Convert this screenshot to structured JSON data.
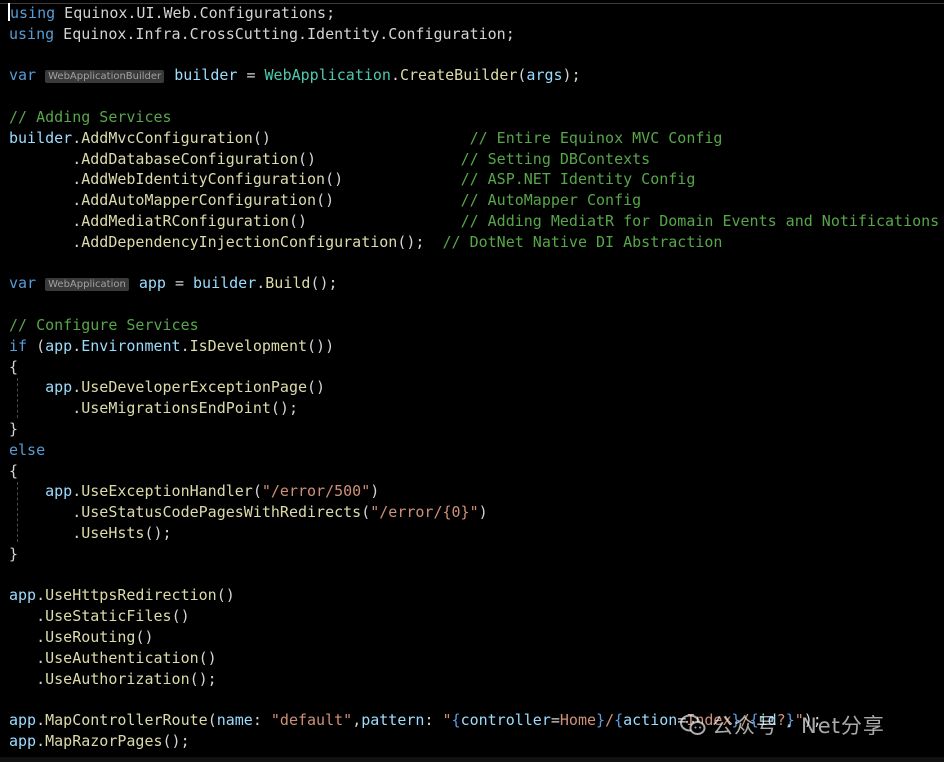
{
  "editor": {
    "lines": [
      [
        {
          "t": "using",
          "c": "kw"
        },
        {
          "t": " Equinox.UI.Web.Configurations;",
          "c": "pn"
        }
      ],
      [
        {
          "t": "using",
          "c": "kw"
        },
        {
          "t": " Equinox.Infra.CrossCutting.Identity.Configuration;",
          "c": "pn"
        }
      ],
      [],
      [
        {
          "t": "var",
          "c": "kw"
        },
        {
          "t": " ",
          "c": "pn"
        },
        {
          "t": "WebApplicationBuilder",
          "c": "hint"
        },
        {
          "t": " builder",
          "c": "va"
        },
        {
          "t": " = ",
          "c": "pn"
        },
        {
          "t": "WebApplication",
          "c": "ty"
        },
        {
          "t": ".",
          "c": "pn"
        },
        {
          "t": "CreateBuilder",
          "c": "fn"
        },
        {
          "t": "(",
          "c": "pn"
        },
        {
          "t": "args",
          "c": "va"
        },
        {
          "t": ");",
          "c": "pn"
        }
      ],
      [],
      [
        {
          "t": "// Adding Services",
          "c": "cm"
        }
      ],
      [
        {
          "t": "builder",
          "c": "va"
        },
        {
          "t": ".",
          "c": "pn"
        },
        {
          "t": "AddMvcConfiguration",
          "c": "fn"
        },
        {
          "t": "()                      ",
          "c": "pn"
        },
        {
          "t": "// Entire Equinox MVC Config",
          "c": "cm"
        }
      ],
      [
        {
          "t": "       .",
          "c": "pn"
        },
        {
          "t": "AddDatabaseConfiguration",
          "c": "fn"
        },
        {
          "t": "()                ",
          "c": "pn"
        },
        {
          "t": "// Setting DBContexts",
          "c": "cm"
        }
      ],
      [
        {
          "t": "       .",
          "c": "pn"
        },
        {
          "t": "AddWebIdentityConfiguration",
          "c": "fn"
        },
        {
          "t": "()             ",
          "c": "pn"
        },
        {
          "t": "// ASP.NET Identity Config",
          "c": "cm"
        }
      ],
      [
        {
          "t": "       .",
          "c": "pn"
        },
        {
          "t": "AddAutoMapperConfiguration",
          "c": "fn"
        },
        {
          "t": "()              ",
          "c": "pn"
        },
        {
          "t": "// AutoMapper Config",
          "c": "cm"
        }
      ],
      [
        {
          "t": "       .",
          "c": "pn"
        },
        {
          "t": "AddMediatRConfiguration",
          "c": "fn"
        },
        {
          "t": "()                 ",
          "c": "pn"
        },
        {
          "t": "// Adding MediatR for Domain Events and Notifications",
          "c": "cm"
        }
      ],
      [
        {
          "t": "       .",
          "c": "pn"
        },
        {
          "t": "AddDependencyInjectionConfiguration",
          "c": "fn"
        },
        {
          "t": "();  ",
          "c": "pn"
        },
        {
          "t": "// DotNet Native DI Abstraction",
          "c": "cm"
        }
      ],
      [],
      [
        {
          "t": "var",
          "c": "kw"
        },
        {
          "t": " ",
          "c": "pn"
        },
        {
          "t": "WebApplication",
          "c": "hint"
        },
        {
          "t": " app",
          "c": "va"
        },
        {
          "t": " = ",
          "c": "pn"
        },
        {
          "t": "builder",
          "c": "va"
        },
        {
          "t": ".",
          "c": "pn"
        },
        {
          "t": "Build",
          "c": "fn"
        },
        {
          "t": "();",
          "c": "pn"
        }
      ],
      [],
      [
        {
          "t": "// Configure Services",
          "c": "cm"
        }
      ],
      [
        {
          "t": "if",
          "c": "kw"
        },
        {
          "t": " (",
          "c": "pn"
        },
        {
          "t": "app",
          "c": "va"
        },
        {
          "t": ".",
          "c": "pn"
        },
        {
          "t": "Environment",
          "c": "va"
        },
        {
          "t": ".",
          "c": "pn"
        },
        {
          "t": "IsDevelopment",
          "c": "fn"
        },
        {
          "t": "())",
          "c": "pn"
        }
      ],
      [
        {
          "t": "{",
          "c": "pn"
        }
      ],
      [
        {
          "t": "    ",
          "c": "pn"
        },
        {
          "t": "app",
          "c": "va"
        },
        {
          "t": ".",
          "c": "pn"
        },
        {
          "t": "UseDeveloperExceptionPage",
          "c": "fn"
        },
        {
          "t": "()",
          "c": "pn"
        }
      ],
      [
        {
          "t": "       .",
          "c": "pn"
        },
        {
          "t": "UseMigrationsEndPoint",
          "c": "fn"
        },
        {
          "t": "();",
          "c": "pn"
        }
      ],
      [
        {
          "t": "}",
          "c": "pn"
        }
      ],
      [
        {
          "t": "else",
          "c": "kw"
        }
      ],
      [
        {
          "t": "{",
          "c": "pn"
        }
      ],
      [
        {
          "t": "    ",
          "c": "pn"
        },
        {
          "t": "app",
          "c": "va"
        },
        {
          "t": ".",
          "c": "pn"
        },
        {
          "t": "UseExceptionHandler",
          "c": "fn"
        },
        {
          "t": "(",
          "c": "pn"
        },
        {
          "t": "\"/error/500\"",
          "c": "st"
        },
        {
          "t": ")",
          "c": "pn"
        }
      ],
      [
        {
          "t": "       .",
          "c": "pn"
        },
        {
          "t": "UseStatusCodePagesWithRedirects",
          "c": "fn"
        },
        {
          "t": "(",
          "c": "pn"
        },
        {
          "t": "\"/error/{0}\"",
          "c": "st"
        },
        {
          "t": ")",
          "c": "pn"
        }
      ],
      [
        {
          "t": "       .",
          "c": "pn"
        },
        {
          "t": "UseHsts",
          "c": "fn"
        },
        {
          "t": "();",
          "c": "pn"
        }
      ],
      [
        {
          "t": "}",
          "c": "pn"
        }
      ],
      [],
      [
        {
          "t": "app",
          "c": "va"
        },
        {
          "t": ".",
          "c": "pn"
        },
        {
          "t": "UseHttpsRedirection",
          "c": "fn"
        },
        {
          "t": "()",
          "c": "pn"
        }
      ],
      [
        {
          "t": "   .",
          "c": "pn"
        },
        {
          "t": "UseStaticFiles",
          "c": "fn"
        },
        {
          "t": "()",
          "c": "pn"
        }
      ],
      [
        {
          "t": "   .",
          "c": "pn"
        },
        {
          "t": "UseRouting",
          "c": "fn"
        },
        {
          "t": "()",
          "c": "pn"
        }
      ],
      [
        {
          "t": "   .",
          "c": "pn"
        },
        {
          "t": "UseAuthentication",
          "c": "fn"
        },
        {
          "t": "()",
          "c": "pn"
        }
      ],
      [
        {
          "t": "   .",
          "c": "pn"
        },
        {
          "t": "UseAuthorization",
          "c": "fn"
        },
        {
          "t": "();",
          "c": "pn"
        }
      ],
      [],
      [
        {
          "t": "app",
          "c": "va"
        },
        {
          "t": ".",
          "c": "pn"
        },
        {
          "t": "MapControllerRoute",
          "c": "fn"
        },
        {
          "t": "(",
          "c": "pn"
        },
        {
          "t": "name",
          "c": "va"
        },
        {
          "t": ": ",
          "c": "pn"
        },
        {
          "t": "\"default\"",
          "c": "st"
        },
        {
          "t": ",",
          "c": "pn"
        },
        {
          "t": "pattern",
          "c": "va"
        },
        {
          "t": ": ",
          "c": "pn"
        },
        {
          "t": "\"",
          "c": "st"
        },
        {
          "t": "{",
          "c": "bl"
        },
        {
          "t": "controller",
          "c": "va"
        },
        {
          "t": "=",
          "c": "pn"
        },
        {
          "t": "Home",
          "c": "st"
        },
        {
          "t": "}",
          "c": "bl"
        },
        {
          "t": "/",
          "c": "st"
        },
        {
          "t": "{",
          "c": "bl"
        },
        {
          "t": "action",
          "c": "va"
        },
        {
          "t": "=",
          "c": "pn"
        },
        {
          "t": "Index",
          "c": "st"
        },
        {
          "t": "}",
          "c": "bl"
        },
        {
          "t": "/",
          "c": "st"
        },
        {
          "t": "{",
          "c": "bl"
        },
        {
          "t": "id",
          "c": "va"
        },
        {
          "t": "?",
          "c": "st"
        },
        {
          "t": "}",
          "c": "bl"
        },
        {
          "t": "\"",
          "c": "st"
        },
        {
          "t": ");",
          "c": "pn"
        }
      ],
      [
        {
          "t": "app",
          "c": "va"
        },
        {
          "t": ".",
          "c": "pn"
        },
        {
          "t": "MapRazorPages",
          "c": "fn"
        },
        {
          "t": "();",
          "c": "pn"
        }
      ]
    ]
  },
  "watermark": {
    "text": "公众号 · Net分享",
    "logo_icon": "wechat-icon"
  },
  "colors": {
    "background": "#000000",
    "keyword": "#569cd6",
    "type": "#4ec9b0",
    "method": "#dcdcaa",
    "variable": "#9cdcfe",
    "string": "#ce9178",
    "comment": "#57a64a"
  }
}
